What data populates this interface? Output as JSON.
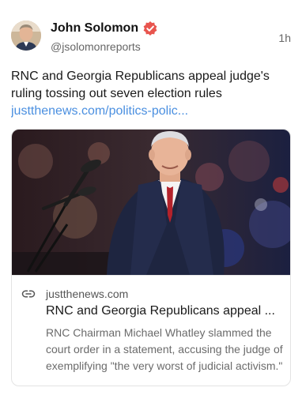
{
  "post": {
    "author_name": "John Solomon",
    "handle": "@jsolomonreports",
    "time": "1h",
    "text": "RNC and Georgia Republicans appeal judge's ruling tossing out seven election rules",
    "link_text": "justthenews.com/politics-polic...",
    "verified_icon": "verified-badge-icon"
  },
  "card": {
    "domain": "justthenews.com",
    "title": "RNC and Georgia Republicans appeal ...",
    "description": "RNC Chairman Michael Whatley slammed the court order in a statement, accusing the judge of exemplifying \"the very worst of judicial activism.\"",
    "link_icon": "link-icon"
  },
  "colors": {
    "link": "#4a8fe0",
    "verified": "#e8554e",
    "muted": "#666666"
  }
}
